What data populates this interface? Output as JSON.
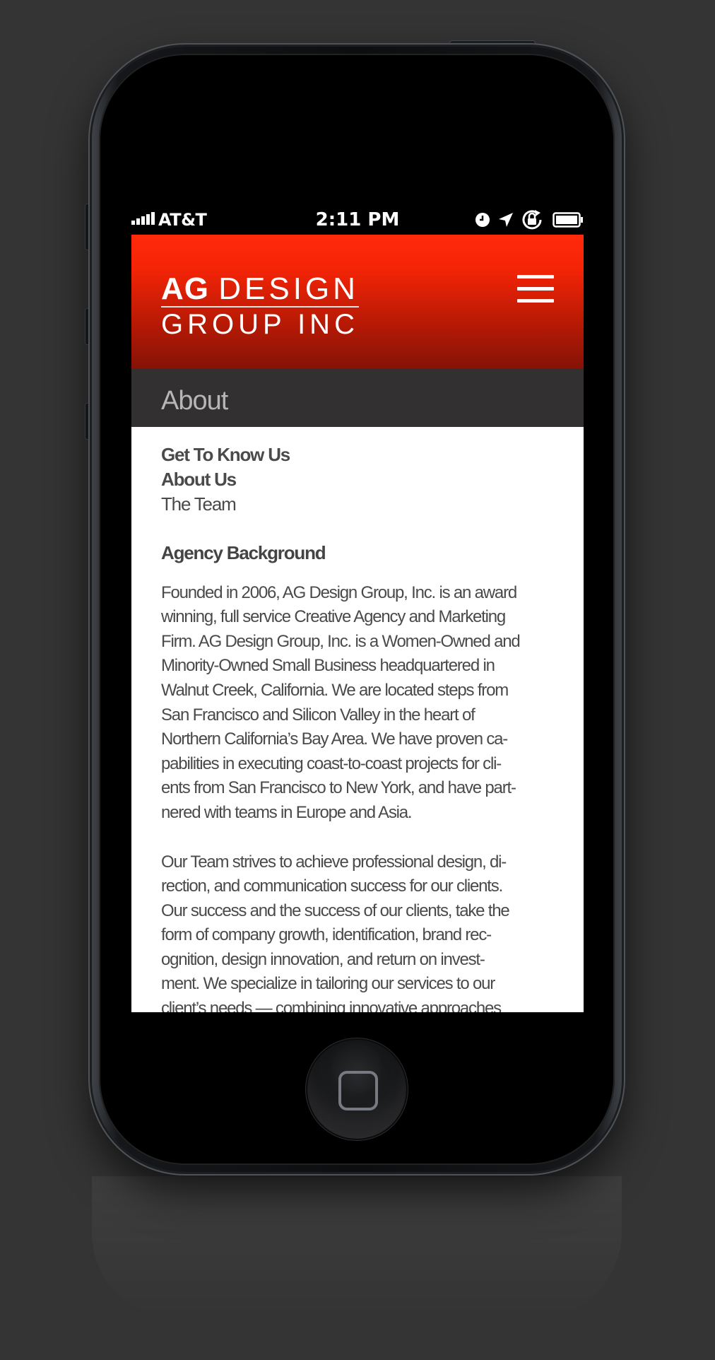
{
  "status_bar": {
    "carrier": "AT&T",
    "time": "2:11 PM",
    "icons": [
      "signal-bars-icon",
      "clock-icon",
      "location-arrow-icon",
      "orientation-lock-icon",
      "battery-icon"
    ]
  },
  "header": {
    "logo": {
      "line1_bold": "AG",
      "line1_light": "DESIGN",
      "line2": "GROUP INC"
    },
    "menu_icon": "hamburger-menu-icon",
    "brand_color": "#f52407"
  },
  "section": {
    "title": "About"
  },
  "subnav": {
    "items": [
      {
        "label": "Get To Know Us"
      },
      {
        "label": "About Us"
      },
      {
        "label": "The Team"
      }
    ]
  },
  "content": {
    "heading": "Agency Background",
    "paragraphs": [
      "Founded in 2006, AG Design Group, Inc. is an award\nwinning, full service Creative Agency and Marketing\nFirm. AG Design Group, Inc. is a Women-Owned and\nMinority-Owned Small Business headquartered in\nWalnut Creek, California. We are located steps from\nSan Francisco and Silicon Valley in the heart of\nNorthern California’s Bay Area. We have proven ca-\npabilities in executing coast-to-coast projects for cli-\nents from San Francisco to New York, and have part-\nnered with teams in Europe and Asia.",
      "Our Team strives to achieve professional design, di-\nrection, and communication success for our clients.\nOur success and the success of our clients, take the\nform of company growth, identification, brand rec-\nognition, design innovation, and return on invest-\nment. We specialize in tailoring our services to our\nclient’s needs — combining innovative approaches"
    ]
  }
}
